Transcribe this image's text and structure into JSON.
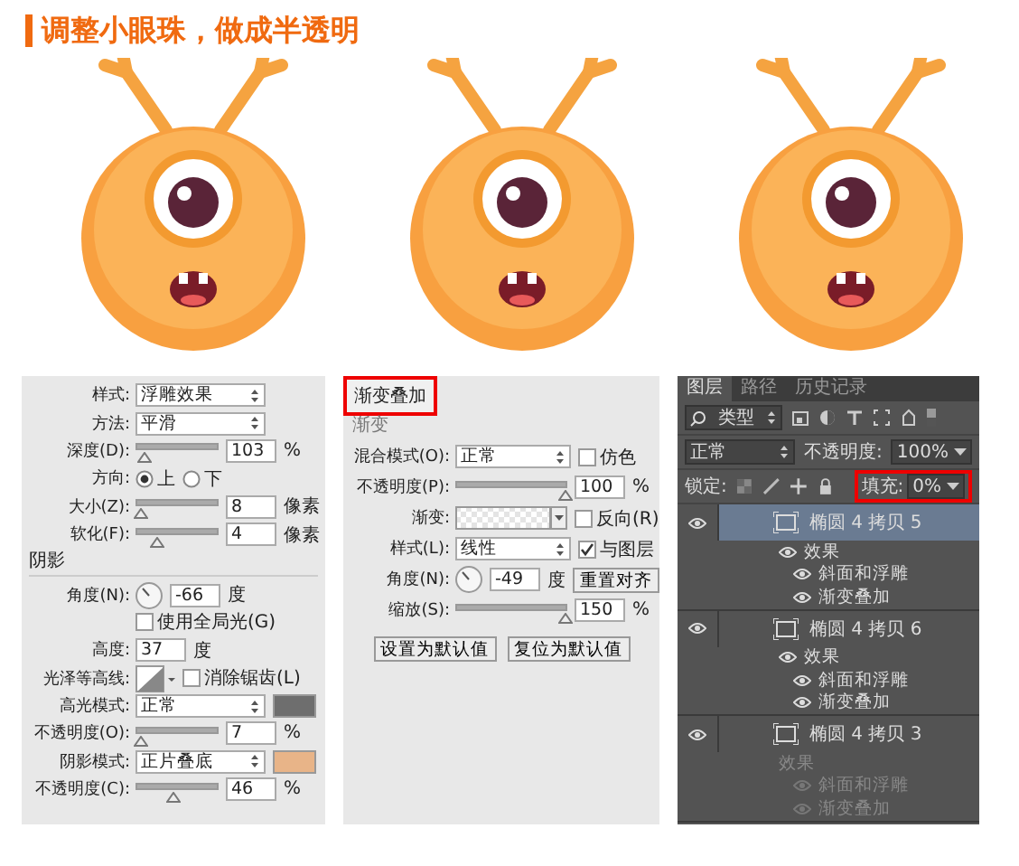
{
  "title": {
    "text": "调整小眼珠，做成半透明"
  },
  "illustrations": [
    {
      "kind": "monster"
    },
    {
      "kind": "monster"
    },
    {
      "kind": "monster"
    }
  ],
  "bevel_panel": {
    "rows": [
      {
        "label": "样式:",
        "controls": [
          {
            "kind": "select",
            "value": "浮雕效果"
          }
        ]
      },
      {
        "label": "方法:",
        "controls": [
          {
            "kind": "select",
            "value": "平滑"
          }
        ]
      },
      {
        "label": "深度(D):",
        "controls": [
          {
            "kind": "slider",
            "level": 0.1
          },
          {
            "kind": "field",
            "value": "103"
          },
          {
            "kind": "unit",
            "text": "%"
          }
        ]
      },
      {
        "label": "方向:",
        "controls": [
          {
            "kind": "radio",
            "label": "上",
            "selected": true
          },
          {
            "kind": "radio",
            "label": "下",
            "selected": false
          }
        ]
      },
      {
        "label": "大小(Z):",
        "controls": [
          {
            "kind": "slider",
            "level": 0.05
          },
          {
            "kind": "field",
            "value": "8"
          },
          {
            "kind": "unit",
            "text": "像素"
          }
        ]
      },
      {
        "label": "软化(F):",
        "controls": [
          {
            "kind": "slider",
            "level": 0.25
          },
          {
            "kind": "field",
            "value": "4"
          },
          {
            "kind": "unit",
            "text": "像素"
          }
        ]
      },
      {
        "heading": "阴影"
      },
      {
        "label": "角度(N):",
        "controls": [
          {
            "kind": "dial"
          },
          {
            "kind": "field",
            "value": "-66"
          },
          {
            "kind": "unit",
            "text": "度"
          }
        ]
      },
      {
        "label": "",
        "controls": [
          {
            "kind": "checkbox",
            "label": "使用全局光(G)",
            "checked": false
          }
        ]
      },
      {
        "label": "高度:",
        "controls": [
          {
            "kind": "field",
            "value": "37"
          },
          {
            "kind": "unit",
            "text": "度"
          }
        ]
      },
      {
        "label": "光泽等高线:",
        "controls": [
          {
            "kind": "contour"
          },
          {
            "kind": "checkbox",
            "label": "消除锯齿(L)",
            "checked": false
          }
        ]
      },
      {
        "label": "高光模式:",
        "controls": [
          {
            "kind": "select",
            "value": "正常"
          },
          {
            "kind": "swatch",
            "color": "#6e6e6e"
          }
        ]
      },
      {
        "label": "不透明度(O):",
        "controls": [
          {
            "kind": "slider",
            "level": 0.05
          },
          {
            "kind": "field",
            "value": "7"
          },
          {
            "kind": "unit",
            "text": "%"
          }
        ]
      },
      {
        "label": "阴影模式:",
        "controls": [
          {
            "kind": "select",
            "value": "正片叠底"
          },
          {
            "kind": "swatch",
            "color": "#e8b488"
          }
        ]
      },
      {
        "label": "不透明度(C):",
        "controls": [
          {
            "kind": "slider",
            "level": 0.46
          },
          {
            "kind": "field",
            "value": "46"
          },
          {
            "kind": "unit",
            "text": "%"
          }
        ]
      }
    ]
  },
  "gradient_panel": {
    "title": "渐变叠加",
    "highlighted": true,
    "rows": [
      {
        "heading": "渐变"
      },
      {
        "label": "混合模式(O):",
        "controls": [
          {
            "kind": "select",
            "value": "正常"
          },
          {
            "kind": "checkbox",
            "label": "仿色",
            "checked": false
          }
        ]
      },
      {
        "label": "不透明度(P):",
        "controls": [
          {
            "kind": "slider",
            "level": 1
          },
          {
            "kind": "field",
            "value": "100"
          },
          {
            "kind": "unit",
            "text": "%"
          }
        ]
      },
      {
        "label": "渐变:",
        "controls": [
          {
            "kind": "gradient"
          },
          {
            "kind": "checkbox",
            "label": "反向(R)",
            "checked": false
          }
        ]
      },
      {
        "label": "样式(L):",
        "controls": [
          {
            "kind": "select",
            "value": "线性"
          },
          {
            "kind": "checkbox",
            "label": "与图层",
            "checked": true
          }
        ]
      },
      {
        "label": "角度(N):",
        "controls": [
          {
            "kind": "dial"
          },
          {
            "kind": "field",
            "value": "-49"
          },
          {
            "kind": "unit",
            "text": "度"
          },
          {
            "kind": "button",
            "label": "重置对齐"
          }
        ]
      },
      {
        "label": "缩放(S):",
        "controls": [
          {
            "kind": "slider",
            "level": 1
          },
          {
            "kind": "field",
            "value": "150"
          },
          {
            "kind": "unit",
            "text": "%"
          }
        ]
      }
    ],
    "buttons": [
      "设置为默认值",
      "复位为默认值"
    ]
  },
  "layers_panel": {
    "tabs": [
      {
        "label": "图层",
        "selected": true
      },
      {
        "label": "路径",
        "selected": false
      },
      {
        "label": "历史记录",
        "selected": false
      }
    ],
    "filter": "类型",
    "blend_mode": "正常",
    "opacity_label": "不透明度:",
    "opacity": "100%",
    "lock_label": "锁定:",
    "fill_label": "填充:",
    "fill": "0%",
    "fill_highlighted": true,
    "layers": [
      {
        "name": "椭圆 4 拷贝 5",
        "selected": true,
        "visible": true,
        "children": [
          {
            "name": "效果",
            "visible": true,
            "children": [
              {
                "name": "斜面和浮雕",
                "visible": true
              },
              {
                "name": "渐变叠加",
                "visible": true
              }
            ]
          }
        ]
      },
      {
        "name": "椭圆 4 拷贝 6",
        "selected": false,
        "visible": true,
        "children": [
          {
            "name": "效果",
            "visible": true,
            "children": [
              {
                "name": "斜面和浮雕",
                "visible": true
              },
              {
                "name": "渐变叠加",
                "visible": true
              }
            ]
          }
        ]
      },
      {
        "name": "椭圆 4 拷贝 3",
        "selected": false,
        "visible": true,
        "children": [
          {
            "name": "效果",
            "visible": false,
            "children": [
              {
                "name": "斜面和浮雕",
                "visible": false
              },
              {
                "name": "渐变叠加",
                "visible": false
              }
            ]
          }
        ]
      }
    ]
  }
}
